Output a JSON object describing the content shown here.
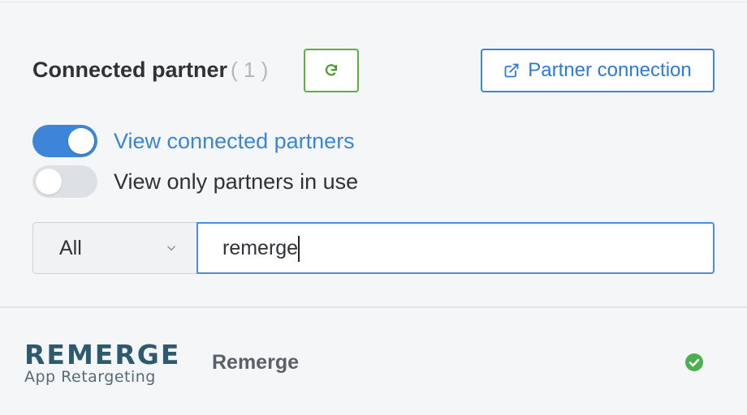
{
  "header": {
    "title": "Connected partner",
    "count": "( 1 )",
    "refresh_icon": "refresh-icon",
    "partner_connection_label": "Partner connection",
    "partner_connection_icon": "external-link-icon"
  },
  "toggles": [
    {
      "label": "View connected partners",
      "on": true
    },
    {
      "label": "View only partners in use",
      "on": false
    }
  ],
  "filter": {
    "select_value": "All",
    "search_value": "remerge"
  },
  "results": [
    {
      "logo_text": "REMERGE",
      "logo_subtext": "App Retargeting",
      "name": "Remerge",
      "status_icon": "check-circle-icon",
      "status_color": "#4caf50"
    }
  ],
  "colors": {
    "accent": "#3d85d8",
    "success": "#5fae3f"
  }
}
